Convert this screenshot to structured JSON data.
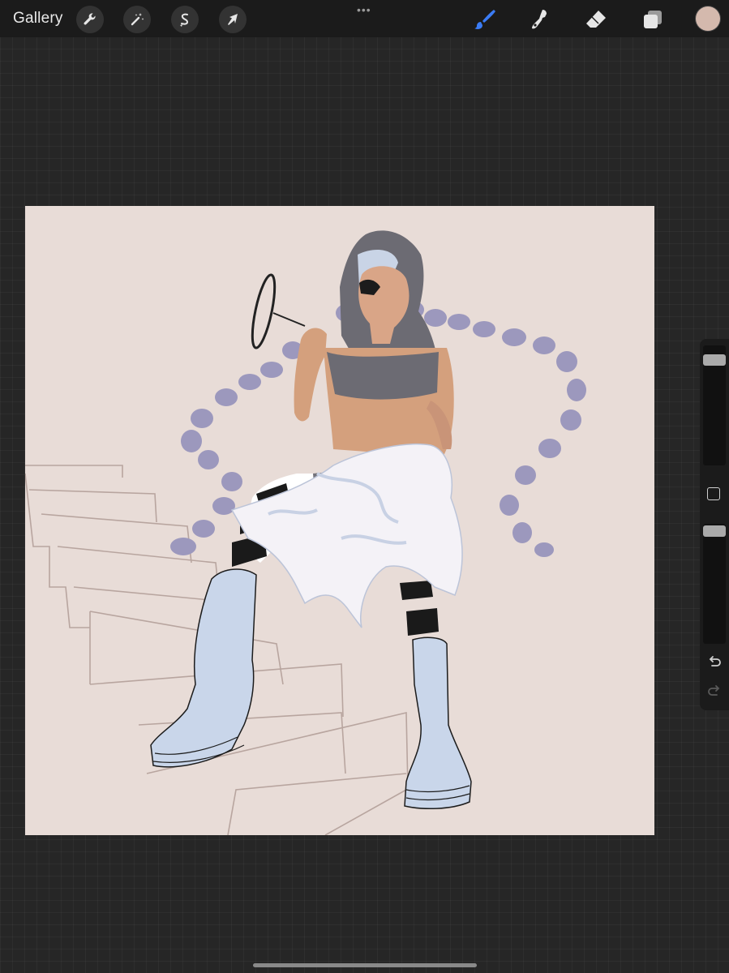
{
  "app": {
    "gallery_label": "Gallery"
  },
  "toolbar": {
    "left_tools": [
      "wrench-icon",
      "magic-wand-icon",
      "selection-icon",
      "transform-arrow-icon"
    ],
    "right_tools": [
      "brush-icon",
      "smudge-icon",
      "eraser-icon",
      "layers-icon"
    ],
    "active_tool": "brush-icon",
    "active_color": "#d4b9ad",
    "accent": "#3b7cf5"
  },
  "canvas": {
    "background_color": "#e8dcd7"
  },
  "sidebar": {
    "brush_size": 0.93,
    "opacity": 1.0,
    "controls": [
      "brush-size-slider",
      "modify-button",
      "opacity-slider",
      "undo-icon",
      "redo-icon"
    ]
  }
}
